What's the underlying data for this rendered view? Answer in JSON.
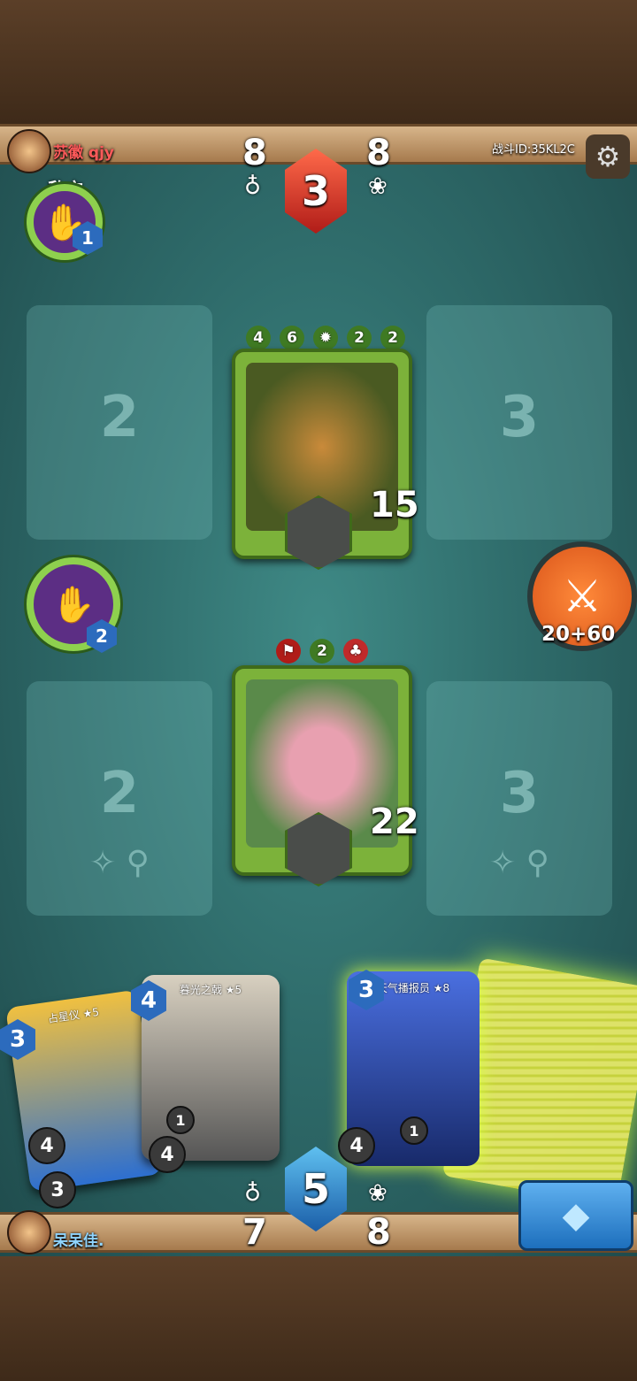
{
  "top_player": {
    "name": "苏徽 qjy",
    "battle_id": "战斗ID:35KL2C",
    "left_stat": "8",
    "right_stat": "8",
    "gem_value": "3"
  },
  "enemy": {
    "label": "敌方",
    "spell_cost": "1"
  },
  "slots": {
    "top_left": "2",
    "top_right": "3",
    "bottom_left": "2",
    "bottom_right": "3"
  },
  "enemy_card": {
    "abilities": [
      "4",
      "6",
      "2",
      "2"
    ],
    "health": "15"
  },
  "player_card": {
    "tag": "2",
    "health": "22"
  },
  "player_spell": {
    "cost": "2"
  },
  "attack": {
    "label": "20+60"
  },
  "hand": [
    {
      "name": "占星仪 ★5",
      "cost": "3",
      "stat_a": "4",
      "stat_b": "3"
    },
    {
      "name": "暮光之戟 ★5",
      "cost": "4",
      "stat_a": "4",
      "stat_b": "1"
    },
    {
      "name": "天气播报员 ★8",
      "cost": "3",
      "stat_a": "4",
      "stat_b": "1"
    }
  ],
  "bottom_player": {
    "name": "呆呆佳.",
    "left_stat": "7",
    "right_stat": "8",
    "gem_value": "5"
  },
  "icons": [
    "gear-icon",
    "potion-icon",
    "paw-icon",
    "crossed-swords-icon",
    "crystal-icon"
  ]
}
